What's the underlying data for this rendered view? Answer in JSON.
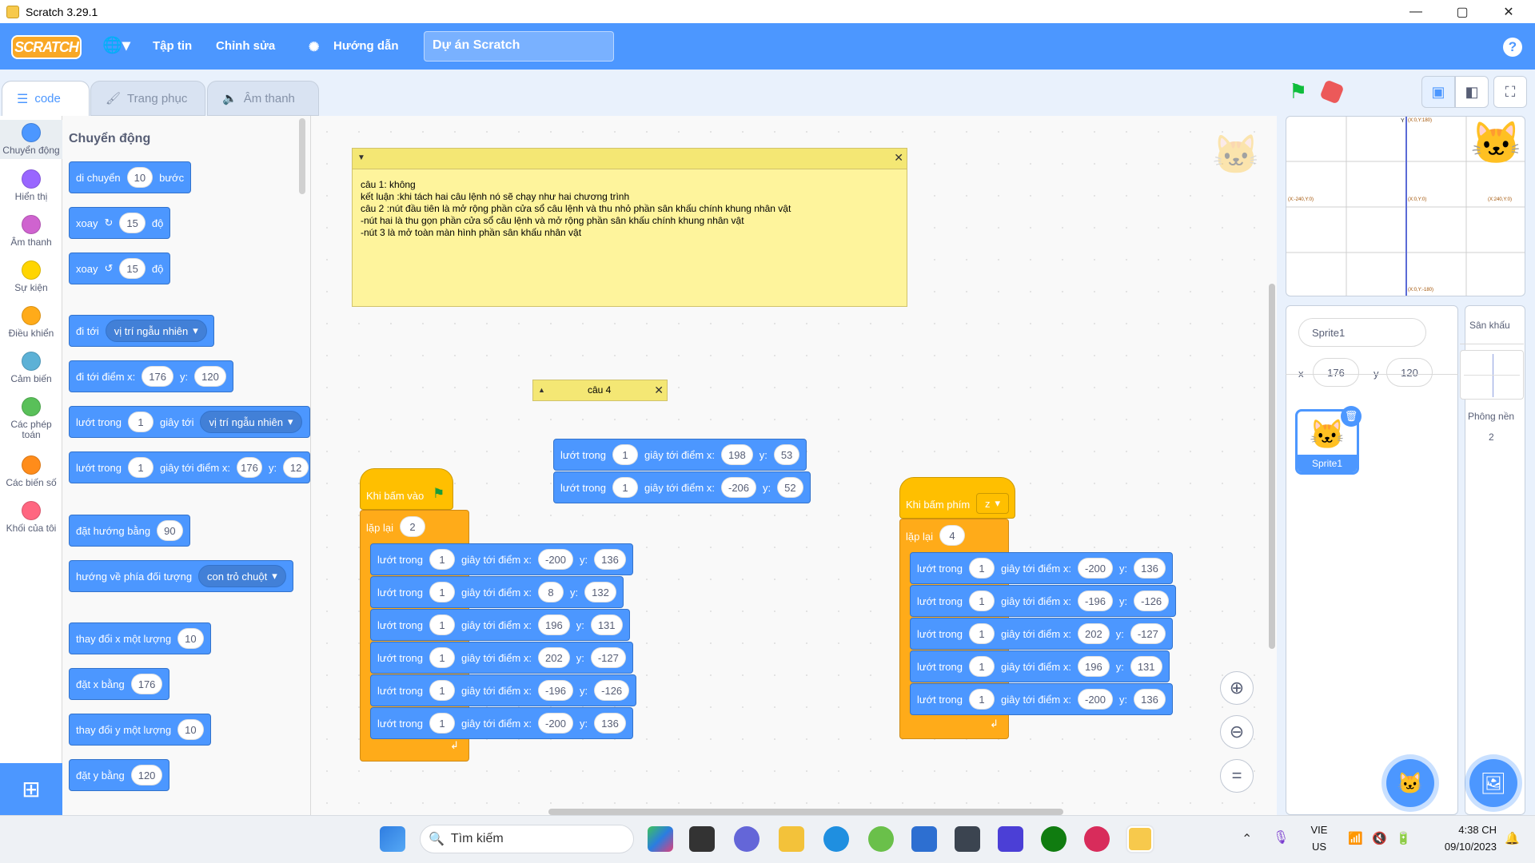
{
  "window": {
    "title": "Scratch 3.29.1",
    "min": "—",
    "max": "▢",
    "close": "✕"
  },
  "menubar": {
    "logo": "SCRATCH",
    "lang_icon": "globe-icon",
    "file": "Tập tin",
    "edit": "Chỉnh sửa",
    "tutorials": "Hướng dẫn",
    "project_title": "Dự án Scratch",
    "help": "?"
  },
  "tabs": {
    "code": "code",
    "costumes": "Trang phục",
    "sounds": "Âm thanh"
  },
  "categories": [
    {
      "label": "Chuyển động",
      "color": "#4c97ff"
    },
    {
      "label": "Hiển thị",
      "color": "#9966ff"
    },
    {
      "label": "Âm thanh",
      "color": "#cf63cf"
    },
    {
      "label": "Sự kiện",
      "color": "#ffd500"
    },
    {
      "label": "Điều khiển",
      "color": "#ffab19"
    },
    {
      "label": "Cảm biến",
      "color": "#5cb1d6"
    },
    {
      "label": "Các phép toán",
      "color": "#59c059"
    },
    {
      "label": "Các biến số",
      "color": "#ff8c1a"
    },
    {
      "label": "Khối của tôi",
      "color": "#ff6680"
    }
  ],
  "palette": {
    "heading": "Chuyển động",
    "b1": {
      "a": "di chuyển",
      "v": "10",
      "b": "bước"
    },
    "b2": {
      "a": "xoay",
      "v": "15",
      "b": "độ"
    },
    "b3": {
      "a": "xoay",
      "v": "15",
      "b": "độ"
    },
    "b4": {
      "a": "đi tới",
      "dd": "vị trí ngẫu nhiên"
    },
    "b5": {
      "a": "đi tới điểm x:",
      "x": "176",
      "yl": "y:",
      "y": "120"
    },
    "b6": {
      "a": "lướt trong",
      "v": "1",
      "b": "giây tới",
      "dd": "vị trí ngẫu nhiên"
    },
    "b7": {
      "a": "lướt trong",
      "v": "1",
      "b": "giây tới điểm x:",
      "x": "176",
      "yl": "y:",
      "y": "12"
    },
    "b8": {
      "a": "đặt hướng bằng",
      "v": "90"
    },
    "b9": {
      "a": "hướng về phía đối tượng",
      "dd": "con trỏ chuột"
    },
    "b10": {
      "a": "thay đổi x một lượng",
      "v": "10"
    },
    "b11": {
      "a": "đặt x bằng",
      "v": "176"
    },
    "b12": {
      "a": "thay đổi y một lượng",
      "v": "10"
    },
    "b13": {
      "a": "đặt y bằng",
      "v": "120"
    }
  },
  "note1": {
    "text": "câu 1: không\nkết luận :khi tách hai câu lệnh nó sẽ chạy như hai chương trình\ncâu 2 :nút đầu tiên là mở rộng phần cửa sổ câu lệnh và thu nhỏ phần sân khấu chính khung nhân vật\n-nút hai là thu gọn phần cửa sổ câu lệnh và mở rộng phần sân khấu chính khung nhân vật\n-nút 3 là mở toàn màn hình phần sân khấu nhân vật"
  },
  "note2": {
    "text": "câu 4"
  },
  "glide_word": "lướt trong",
  "glide_mid": "giây tới điểm x:",
  "ylabel": "y:",
  "loose": [
    {
      "s": "1",
      "x": "198",
      "y": "53"
    },
    {
      "s": "1",
      "x": "-206",
      "y": "52"
    }
  ],
  "script1": {
    "hat": "Khi bấm vào",
    "repeat": "lặp lại",
    "times": "2",
    "rows": [
      {
        "s": "1",
        "x": "-200",
        "y": "136"
      },
      {
        "s": "1",
        "x": "8",
        "y": "132"
      },
      {
        "s": "1",
        "x": "196",
        "y": "131"
      },
      {
        "s": "1",
        "x": "202",
        "y": "-127"
      },
      {
        "s": "1",
        "x": "-196",
        "y": "-126"
      },
      {
        "s": "1",
        "x": "-200",
        "y": "136"
      }
    ]
  },
  "script2": {
    "hat": "Khi bấm phím",
    "key": "z",
    "repeat": "lặp lại",
    "times": "4",
    "rows": [
      {
        "s": "1",
        "x": "-200",
        "y": "136"
      },
      {
        "s": "1",
        "x": "-196",
        "y": "-126"
      },
      {
        "s": "1",
        "x": "202",
        "y": "-127"
      },
      {
        "s": "1",
        "x": "196",
        "y": "131"
      },
      {
        "s": "1",
        "x": "-200",
        "y": "136"
      }
    ]
  },
  "stage": {
    "labels": {
      "top": "(X:0,Y:180)",
      "left": "(X:-240,Y:0)",
      "center": "(X:0,Y:0)",
      "right": "(X:240,Y:0)",
      "bottom": "(X:0,Y:-180)",
      "yaxis": "Y"
    }
  },
  "sprite": {
    "name": "Sprite1",
    "x_label": "x",
    "x": "176",
    "y_label": "y",
    "y": "120",
    "thumb_label": "Sprite1"
  },
  "stagepane": {
    "title": "Sân khấu",
    "backdrops_label": "Phông nền",
    "backdrops": "2"
  },
  "taskbar": {
    "search": "Tìm kiếm",
    "lang": "VIE",
    "region": "US",
    "time": "4:38 CH",
    "date": "09/10/2023"
  }
}
